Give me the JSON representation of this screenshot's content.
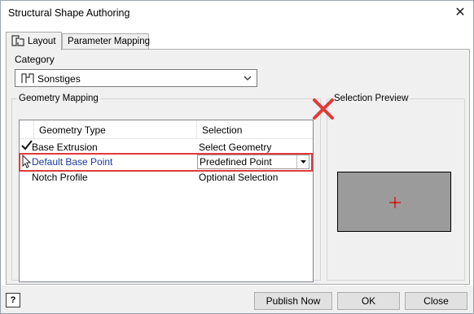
{
  "window": {
    "title": "Structural Shape Authoring"
  },
  "tabs": [
    {
      "label": "Layout",
      "active": true
    },
    {
      "label": "Parameter Mapping",
      "active": false
    }
  ],
  "category": {
    "label": "Category",
    "value": "Sonstiges"
  },
  "geometry_mapping": {
    "legend": "Geometry Mapping",
    "columns": [
      "Geometry Type",
      "Selection"
    ],
    "rows": [
      {
        "type": "Base Extrusion",
        "selection": "Select Geometry",
        "checked": true,
        "status": "done"
      },
      {
        "type": "Default Base Point",
        "selection": "Predefined Point",
        "checked": false,
        "status": "active-dropdown"
      },
      {
        "type": "Notch Profile",
        "selection": "Optional Selection",
        "checked": false,
        "status": "none"
      }
    ]
  },
  "selection_preview": {
    "legend": "Selection Preview"
  },
  "buttons": {
    "help": "?",
    "publish": "Publish Now",
    "ok": "OK",
    "close": "Close"
  },
  "colors": {
    "highlight": "#e03a3a",
    "preview_bg": "#9b9b9b",
    "marker": "#e00000",
    "link_text": "#1a3a9a"
  },
  "icons": {
    "tab_layout": "layout-shape-icon",
    "category": "category-shape-icon",
    "checkmark": "checkmark-icon",
    "cursor": "mouse-cursor-icon",
    "error": "red-x-icon",
    "preview_marker": "crosshair-icon"
  }
}
